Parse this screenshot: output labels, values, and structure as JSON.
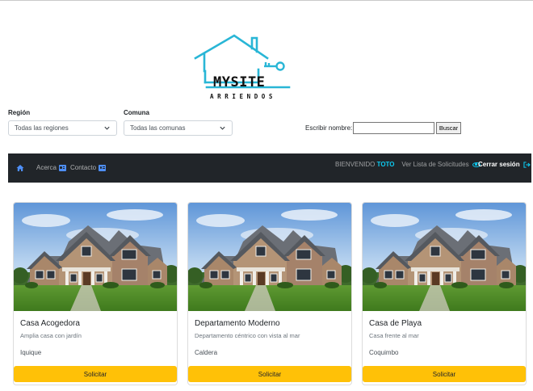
{
  "brand": {
    "title": "MYSITE",
    "subtitle": "ARRIENDOS",
    "accent": "#29b6d6"
  },
  "filters": {
    "region_label": "Región",
    "region_value": "Todas las regiones",
    "commune_label": "Comuna",
    "commune_value": "Todas las comunas",
    "search_label": "Escribir nombre:",
    "search_value": "",
    "search_button": "Buscar"
  },
  "nav": {
    "home_icon": "house-icon",
    "about": "Acerca",
    "contact": "Contacto",
    "welcome_prefix": "BIENVENIDO",
    "user": "TOTO",
    "requests_link": "Ver Lista de Solicitudes",
    "logout": "Cerrar sesión",
    "link_color": "#0dcaf0",
    "bar_color": "#212529"
  },
  "listings": [
    {
      "title": "Casa Acogedora",
      "description": "Amplia casa con jardín",
      "city": "Iquique",
      "button": "Solicitar"
    },
    {
      "title": "Departamento Moderno",
      "description": "Departamento céntrico con vista al mar",
      "city": "Caldera",
      "button": "Solicitar"
    },
    {
      "title": "Casa de Playa",
      "description": "Casa frente al mar",
      "city": "Coquimbo",
      "button": "Solicitar"
    }
  ],
  "button_color": "#ffc107"
}
